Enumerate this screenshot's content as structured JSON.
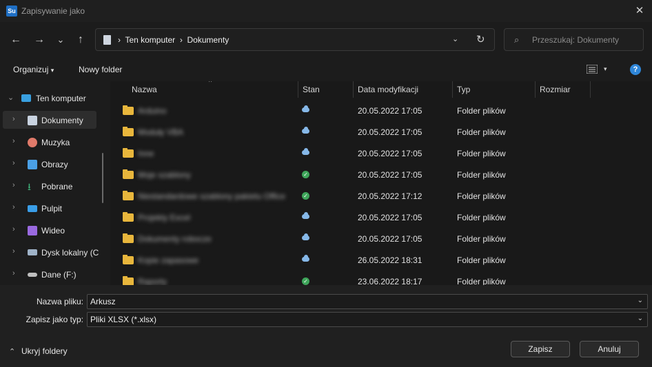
{
  "window": {
    "app_icon_text": "Su",
    "title": "Zapisywanie jako",
    "close_glyph": "✕"
  },
  "nav": {
    "back": "←",
    "forward": "→",
    "recent": "⌄",
    "up": "↑",
    "refresh": "↻",
    "dropdown": "⌄"
  },
  "address": {
    "sep": "›",
    "crumbs": [
      "Ten komputer",
      "Dokumenty"
    ]
  },
  "search": {
    "placeholder": "Przeszukaj: Dokumenty",
    "icon": "⌕"
  },
  "toolbar": {
    "organize": "Organizuj",
    "new_folder": "Nowy folder",
    "help": "?",
    "caret": "▾"
  },
  "sidebar": {
    "root": {
      "label": "Ten komputer",
      "chevron": "⌄"
    },
    "items": [
      {
        "label": "Dokumenty",
        "chevron": "›",
        "icon": "document-icon",
        "color": "#c9d3e0"
      },
      {
        "label": "Muzyka",
        "chevron": "›",
        "icon": "music-icon",
        "color": "#e07a6a"
      },
      {
        "label": "Obrazy",
        "chevron": "›",
        "icon": "pictures-icon",
        "color": "#4aa0e6"
      },
      {
        "label": "Pobrane",
        "chevron": "›",
        "icon": "download-icon",
        "color": "#3fb37a"
      },
      {
        "label": "Pulpit",
        "chevron": "›",
        "icon": "desktop-icon",
        "color": "#3a9ee8"
      },
      {
        "label": "Wideo",
        "chevron": "›",
        "icon": "video-icon",
        "color": "#9a6ae0"
      },
      {
        "label": "Dysk lokalny (C",
        "chevron": "›",
        "icon": "drive-icon",
        "color": "#9fb3c8"
      },
      {
        "label": "Dane (F:)",
        "chevron": "›",
        "icon": "drive-icon",
        "color": "#bfbfbf"
      }
    ]
  },
  "columns": {
    "name": "Nazwa",
    "status": "Stan",
    "date": "Data modyfikacji",
    "type": "Typ",
    "size": "Rozmiar",
    "sort_glyph": "^"
  },
  "files": [
    {
      "name": "Arduino",
      "status": "cloud",
      "date": "20.05.2022 17:05",
      "type": "Folder plików"
    },
    {
      "name": "Moduły VBA",
      "status": "cloud",
      "date": "20.05.2022 17:05",
      "type": "Folder plików"
    },
    {
      "name": "Inne",
      "status": "cloud",
      "date": "20.05.2022 17:05",
      "type": "Folder plików"
    },
    {
      "name": "Moje szablony",
      "status": "ok",
      "date": "20.05.2022 17:05",
      "type": "Folder plików"
    },
    {
      "name": "Niestandardowe szablony pakietu Office",
      "status": "ok",
      "date": "20.05.2022 17:12",
      "type": "Folder plików"
    },
    {
      "name": "Projekty Excel",
      "status": "cloud",
      "date": "20.05.2022 17:05",
      "type": "Folder plików"
    },
    {
      "name": "Dokumenty robocze",
      "status": "cloud",
      "date": "20.05.2022 17:05",
      "type": "Folder plików"
    },
    {
      "name": "Kopie zapasowe",
      "status": "cloud",
      "date": "26.05.2022 18:31",
      "type": "Folder plików"
    },
    {
      "name": "Raporty",
      "status": "ok",
      "date": "23.06.2022 18:17",
      "type": "Folder plików"
    }
  ],
  "form": {
    "file_name_label": "Nazwa pliku:",
    "file_name_value": "Arkusz",
    "file_type_label": "Zapisz jako typ:",
    "file_type_value": "Pliki XLSX (*.xlsx)",
    "combo_arrow": "⌄"
  },
  "footer": {
    "hide_folders": "Ukryj foldery",
    "hide_chevron": "⌃",
    "save": "Zapisz",
    "cancel": "Anuluj"
  }
}
